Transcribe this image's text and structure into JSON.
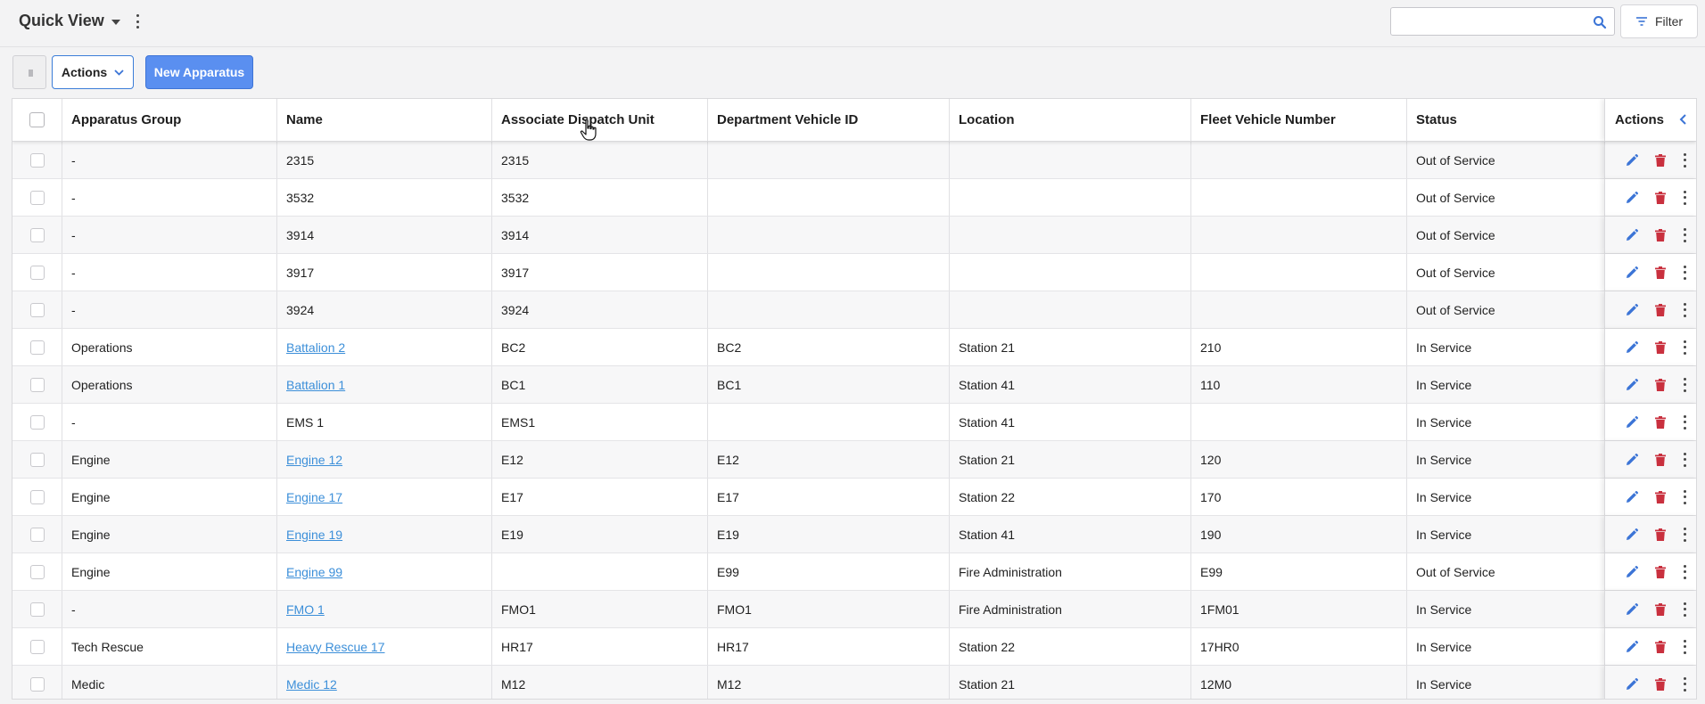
{
  "header": {
    "title": "Quick View",
    "search_placeholder": "",
    "filter_label": "Filter"
  },
  "toolbar": {
    "actions_label": "Actions",
    "new_label": "New Apparatus"
  },
  "table": {
    "columns": [
      "Apparatus Group",
      "Name",
      "Associate Dispatch Unit",
      "Department Vehicle ID",
      "Location",
      "Fleet Vehicle Number",
      "Status"
    ],
    "actions_header": "Actions",
    "rows": [
      {
        "group": "-",
        "name": "2315",
        "name_link": false,
        "dispatch": "2315",
        "vehicle_id": "",
        "location": "",
        "fleet": "",
        "status": "Out of Service"
      },
      {
        "group": "-",
        "name": "3532",
        "name_link": false,
        "dispatch": "3532",
        "vehicle_id": "",
        "location": "",
        "fleet": "",
        "status": "Out of Service"
      },
      {
        "group": "-",
        "name": "3914",
        "name_link": false,
        "dispatch": "3914",
        "vehicle_id": "",
        "location": "",
        "fleet": "",
        "status": "Out of Service"
      },
      {
        "group": "-",
        "name": "3917",
        "name_link": false,
        "dispatch": "3917",
        "vehicle_id": "",
        "location": "",
        "fleet": "",
        "status": "Out of Service"
      },
      {
        "group": "-",
        "name": "3924",
        "name_link": false,
        "dispatch": "3924",
        "vehicle_id": "",
        "location": "",
        "fleet": "",
        "status": "Out of Service"
      },
      {
        "group": "Operations",
        "name": "Battalion 2",
        "name_link": true,
        "dispatch": "BC2",
        "vehicle_id": "BC2",
        "location": "Station 21",
        "fleet": "210",
        "status": "In Service"
      },
      {
        "group": "Operations",
        "name": "Battalion 1",
        "name_link": true,
        "dispatch": "BC1",
        "vehicle_id": "BC1",
        "location": "Station 41",
        "fleet": "110",
        "status": "In Service"
      },
      {
        "group": "-",
        "name": "EMS 1",
        "name_link": false,
        "dispatch": "EMS1",
        "vehicle_id": "",
        "location": "Station 41",
        "fleet": "",
        "status": "In Service"
      },
      {
        "group": "Engine",
        "name": "Engine 12",
        "name_link": true,
        "dispatch": "E12",
        "vehicle_id": "E12",
        "location": "Station 21",
        "fleet": "120",
        "status": "In Service"
      },
      {
        "group": "Engine",
        "name": "Engine 17",
        "name_link": true,
        "dispatch": "E17",
        "vehicle_id": "E17",
        "location": "Station 22",
        "fleet": "170",
        "status": "In Service"
      },
      {
        "group": "Engine",
        "name": "Engine 19",
        "name_link": true,
        "dispatch": "E19",
        "vehicle_id": "E19",
        "location": "Station 41",
        "fleet": "190",
        "status": "In Service"
      },
      {
        "group": "Engine",
        "name": "Engine 99",
        "name_link": true,
        "dispatch": "",
        "vehicle_id": "E99",
        "location": "Fire Administration",
        "fleet": "E99",
        "status": "Out of Service"
      },
      {
        "group": "-",
        "name": "FMO 1",
        "name_link": true,
        "dispatch": "FMO1",
        "vehicle_id": "FMO1",
        "location": "Fire Administration",
        "fleet": "1FM01",
        "status": "In Service"
      },
      {
        "group": "Tech Rescue",
        "name": "Heavy Rescue 17",
        "name_link": true,
        "dispatch": "HR17",
        "vehicle_id": "HR17",
        "location": "Station 22",
        "fleet": "17HR0",
        "status": "In Service"
      },
      {
        "group": "Medic",
        "name": "Medic 12",
        "name_link": true,
        "dispatch": "M12",
        "vehicle_id": "M12",
        "location": "Station 21",
        "fleet": "12M0",
        "status": "In Service"
      }
    ]
  },
  "icons": {
    "edit": "pencil-icon",
    "delete": "trash-icon",
    "more": "kebab-icon",
    "search": "search-icon",
    "filter": "filter-icon"
  },
  "colors": {
    "accent": "#5a8ff0",
    "link": "#3c8fd9",
    "edit_icon": "#3b74d6",
    "delete_icon": "#c9303e"
  }
}
